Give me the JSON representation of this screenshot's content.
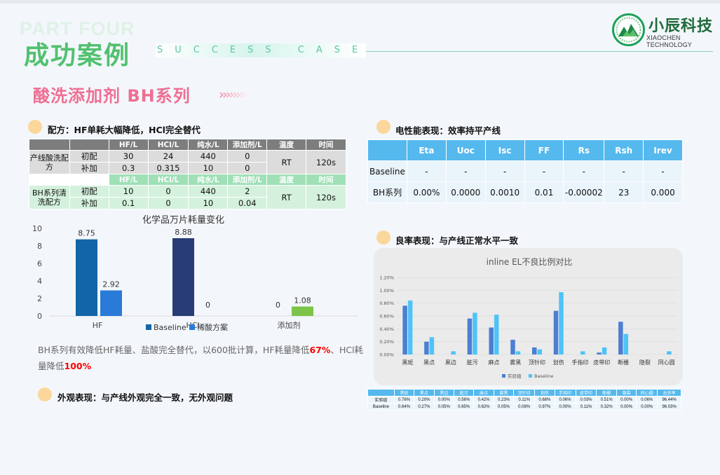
{
  "header": {
    "ghost": "PART FOUR",
    "title": "成功案例",
    "success": "SUCCESS CASE",
    "logo_name": "小辰科技",
    "logo_sub": "XIAOCHEN TECHNOLOGY"
  },
  "subtitle": "酸洗添加剂 BH系列",
  "subtitle_arrows": "››››››››",
  "section_formula": "配方：HF单耗大幅降低，HCl完全替代",
  "section_electrical": "电性能表现：效率持平产线",
  "section_yield": "良率表现：与产线正常水平一致",
  "section_appearance": "外观表现：与产线外观完全一致，无外观问题",
  "recipe_table": {
    "headers": [
      "HF/L",
      "HCl/L",
      "纯水/L",
      "添加剂/L",
      "温度",
      "时间"
    ],
    "baseline_name": "产线酸洗配方",
    "bh_name": "BH系列清洗配方",
    "rows_baseline": [
      {
        "label": "初配",
        "hf": "30",
        "hcl": "24",
        "water": "440",
        "add": "0"
      },
      {
        "label": "补加",
        "hf": "0.3",
        "hcl": "0.315",
        "water": "10",
        "add": "0"
      }
    ],
    "rows_bh": [
      {
        "label": "初配",
        "hf": "10",
        "hcl": "0",
        "water": "440",
        "add": "2"
      },
      {
        "label": "补加",
        "hf": "0.1",
        "hcl": "0",
        "water": "10",
        "add": "0.04"
      }
    ],
    "temp": "RT",
    "time": "120s"
  },
  "electrical_table": {
    "headers": [
      "Eta",
      "Uoc",
      "Isc",
      "FF",
      "Rs",
      "Rsh",
      "Irev"
    ],
    "rows": [
      {
        "label": "Baseline",
        "values": [
          "-",
          "-",
          "-",
          "-",
          "-",
          "-",
          "-"
        ]
      },
      {
        "label": "BH系列",
        "values": [
          "0.00%",
          "0.0000",
          "0.0010",
          "0.01",
          "-0.00002",
          "23",
          "0.000"
        ]
      }
    ]
  },
  "chart_data": [
    {
      "type": "bar",
      "title": "化学品万片耗量变化",
      "categories": [
        "HF",
        "HCl",
        "添加剂"
      ],
      "series": [
        {
          "name": "Baseline",
          "values": [
            8.75,
            8.88,
            0
          ],
          "color": "#1265a6"
        },
        {
          "name": "稀酸方案",
          "values": [
            2.92,
            0,
            1.08
          ],
          "color": "#2a7ad8"
        }
      ],
      "series_colors": [
        "#1265a6",
        "#2a7ad8"
      ],
      "special_colors": {
        "HCl_baseline": "#283c75",
        "additive_new": "#7dc44a"
      },
      "ylim": [
        0,
        10
      ],
      "yticks": [
        0,
        2,
        4,
        6,
        8,
        10
      ],
      "legend": "bottom"
    },
    {
      "type": "bar",
      "title": "inline EL不良比例对比",
      "categories": [
        "黑斑",
        "黑点",
        "黑边",
        "脏污",
        "麻点",
        "雾黑",
        "顶针印",
        "划伤",
        "手指印",
        "皮带印",
        "断栅",
        "隐裂",
        "同心圆"
      ],
      "series": [
        {
          "name": "实验组",
          "values": [
            0.76,
            0.2,
            0.0,
            0.56,
            0.42,
            0.23,
            0.11,
            0.68,
            0.0,
            0.03,
            0.51,
            0.0,
            0.0
          ],
          "color": "#4b7fd1"
        },
        {
          "name": "Baseline",
          "values": [
            0.84,
            0.27,
            0.05,
            0.65,
            0.62,
            0.05,
            0.08,
            0.97,
            0.05,
            0.11,
            0.32,
            0.0,
            0.05
          ],
          "color": "#4fc3f7"
        }
      ],
      "ylim": [
        0,
        1.2
      ],
      "yticks": [
        "0.00%",
        "0.20%",
        "0.40%",
        "0.60%",
        "0.80%",
        "1.00%",
        "1.20%"
      ],
      "legend": "bottom"
    }
  ],
  "el_table": {
    "headers": [
      "",
      "黑斑",
      "黑点",
      "黑边",
      "脏污",
      "麻点",
      "雾黑",
      "顶针印",
      "划伤",
      "手指印",
      "皮带印",
      "断栅",
      "隐裂",
      "同心圆",
      "总良率"
    ],
    "rows": [
      [
        "实验组",
        "0.76%",
        "0.20%",
        "0.00%",
        "0.56%",
        "0.42%",
        "0.23%",
        "0.11%",
        "0.68%",
        "0.06%",
        "0.03%",
        "0.51%",
        "0.00%",
        "0.06%",
        "96.44%"
      ],
      [
        "Baseline",
        "0.64%",
        "0.27%",
        "0.05%",
        "0.65%",
        "0.62%",
        "0.05%",
        "0.08%",
        "0.97%",
        "0.00%",
        "0.11%",
        "0.32%",
        "0.00%",
        "0.00%",
        "96.03%"
      ]
    ]
  },
  "note": {
    "part1": "BH系列有效降低HF耗量、盐酸完全替代，以600批计算，HF耗量降低",
    "pct1": "67%",
    "part2": "、HCl耗量降低",
    "pct2": "100%"
  }
}
